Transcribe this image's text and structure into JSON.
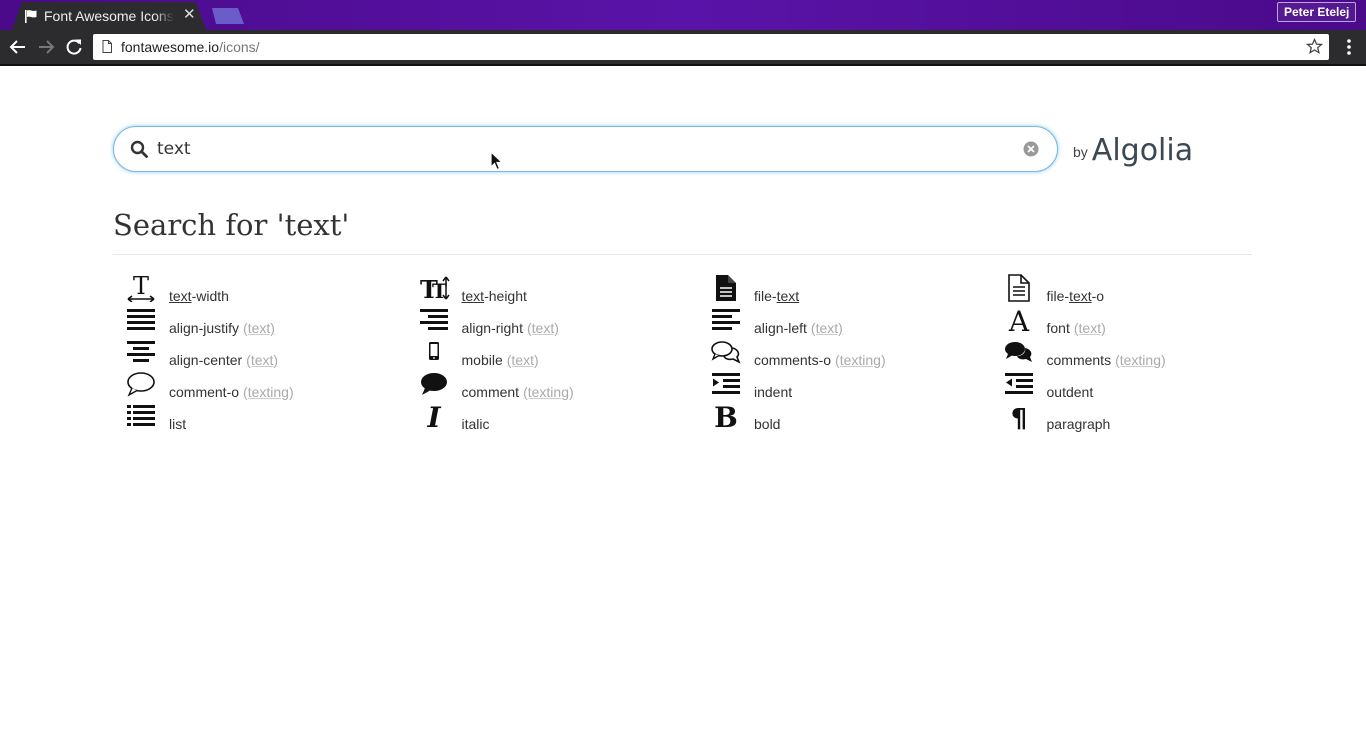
{
  "browser": {
    "tab_title": "Font Awesome Icons",
    "profile_name": "Peter Etelej",
    "url_host": "fontawesome.io",
    "url_path": "/icons/",
    "accent": "#5a13a8"
  },
  "search": {
    "value": "text",
    "by_label": "by",
    "brand": "Algolia",
    "focus_color": "#7ab8df"
  },
  "heading": "Search for 'text'",
  "results": [
    {
      "pre": "",
      "match": "text",
      "post": "-width",
      "alias": "",
      "icon": "text-width-icon"
    },
    {
      "pre": "",
      "match": "text",
      "post": "-height",
      "alias": "",
      "icon": "text-height-icon"
    },
    {
      "pre": "file-",
      "match": "text",
      "post": "",
      "alias": "",
      "icon": "file-text-icon"
    },
    {
      "pre": "file-",
      "match": "text",
      "post": "-o",
      "alias": "",
      "icon": "file-text-o-icon"
    },
    {
      "pre": "align-justify",
      "match": "",
      "post": "",
      "alias": "(text)",
      "icon": "align-justify-icon"
    },
    {
      "pre": "align-right",
      "match": "",
      "post": "",
      "alias": "(text)",
      "icon": "align-right-icon"
    },
    {
      "pre": "align-left",
      "match": "",
      "post": "",
      "alias": "(text)",
      "icon": "align-left-icon"
    },
    {
      "pre": "font",
      "match": "",
      "post": "",
      "alias": "(text)",
      "icon": "font-icon"
    },
    {
      "pre": "align-center",
      "match": "",
      "post": "",
      "alias": "(text)",
      "icon": "align-center-icon"
    },
    {
      "pre": "mobile",
      "match": "",
      "post": "",
      "alias": "(text)",
      "icon": "mobile-icon"
    },
    {
      "pre": "comments-o",
      "match": "",
      "post": "",
      "alias": "(texting)",
      "icon": "comments-o-icon"
    },
    {
      "pre": "comments",
      "match": "",
      "post": "",
      "alias": "(texting)",
      "icon": "comments-icon"
    },
    {
      "pre": "comment-o",
      "match": "",
      "post": "",
      "alias": "(texting)",
      "icon": "comment-o-icon"
    },
    {
      "pre": "comment",
      "match": "",
      "post": "",
      "alias": "(texting)",
      "icon": "comment-icon"
    },
    {
      "pre": "indent",
      "match": "",
      "post": "",
      "alias": "",
      "icon": "indent-icon"
    },
    {
      "pre": "outdent",
      "match": "",
      "post": "",
      "alias": "",
      "icon": "outdent-icon"
    },
    {
      "pre": "list",
      "match": "",
      "post": "",
      "alias": "",
      "icon": "list-icon"
    },
    {
      "pre": "italic",
      "match": "",
      "post": "",
      "alias": "",
      "icon": "italic-icon"
    },
    {
      "pre": "bold",
      "match": "",
      "post": "",
      "alias": "",
      "icon": "bold-icon"
    },
    {
      "pre": "paragraph",
      "match": "",
      "post": "",
      "alias": "",
      "icon": "paragraph-icon"
    }
  ]
}
